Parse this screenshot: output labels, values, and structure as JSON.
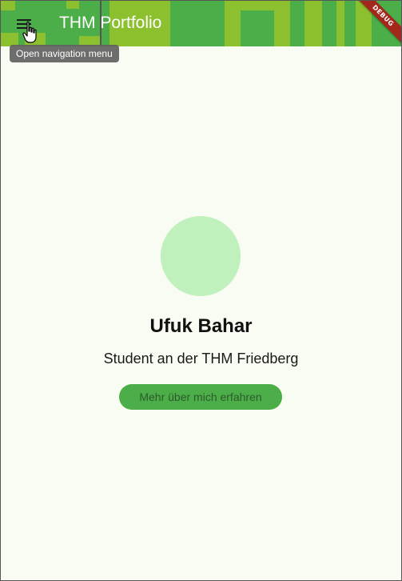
{
  "app_bar": {
    "title": "THM Portfolio",
    "menu_icon": "hamburger-menu-icon",
    "background_color": "#4cae48",
    "pattern_color": "#8cc02e"
  },
  "tooltip": {
    "text": "Open navigation menu"
  },
  "debug_banner": {
    "label": "DEBUG",
    "color": "#a3271b"
  },
  "profile": {
    "avatar_color": "#c0f0bc",
    "name": "Ufuk Bahar",
    "subtitle": "Student an der THM Friedberg",
    "button_label": "Mehr über mich erfahren",
    "button_color": "#4cae48"
  },
  "cursor": {
    "icon": "hand-pointer-cursor-icon"
  }
}
